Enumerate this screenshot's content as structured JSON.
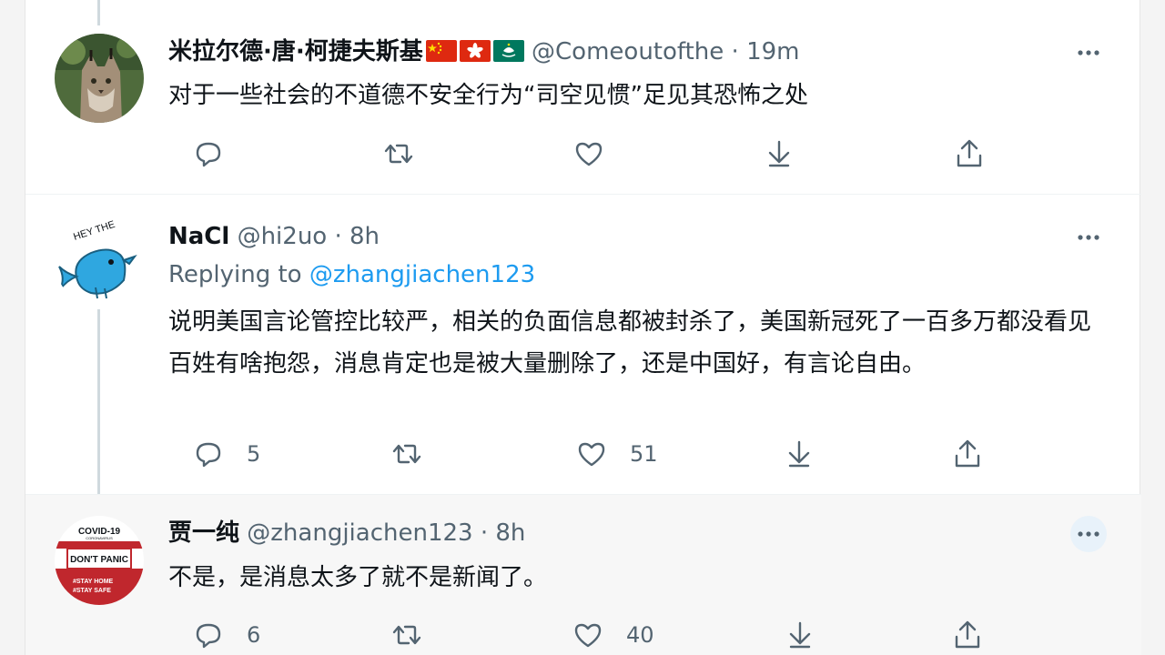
{
  "tweets": [
    {
      "name": "米拉尔德·唐·柯捷夫斯基",
      "handle": "@Comeoutofthe",
      "sep": "·",
      "time": "19m",
      "text": "对于一些社会的不道德不安全行为“司空见惯”足见其恐怖之处",
      "counts": {
        "reply": "",
        "retweet": "",
        "like": ""
      }
    },
    {
      "name": "NaCl",
      "handle": "@hi2uo",
      "sep": "·",
      "time": "8h",
      "replying_label": "Replying to",
      "replying_to": "@zhangjiachen123",
      "text": "说明美国言论管控比较严，相关的负面信息都被封杀了，美国新冠死了一百多万都没看见百姓有啥抱怨，消息肯定也是被大量删除了，还是中国好，有言论自由。",
      "avatar_caption": "HEY THE",
      "counts": {
        "reply": "5",
        "retweet": "",
        "like": "51"
      }
    },
    {
      "name": "贾一纯",
      "handle": "@zhangjiachen123",
      "sep": "·",
      "time": "8h",
      "text": "不是，是消息太多了就不是新闻了。",
      "avatar_text": {
        "top": "COVID-19",
        "sub": "CORONAVIRUS",
        "mid": "DON'T PANIC",
        "b1": "#STAY HOME",
        "b2": "#STAY SAFE"
      },
      "counts": {
        "reply": "6",
        "retweet": "",
        "like": "40"
      }
    }
  ],
  "icons": {
    "reply": "speech-bubble-icon",
    "retweet": "retweet-arrows-icon",
    "like": "heart-icon",
    "download": "download-arrow-icon",
    "share": "share-upload-icon",
    "more": "three-dots-icon"
  },
  "colors": {
    "link": "#1d9bf0",
    "muted": "#536471",
    "text": "#0f1419"
  }
}
